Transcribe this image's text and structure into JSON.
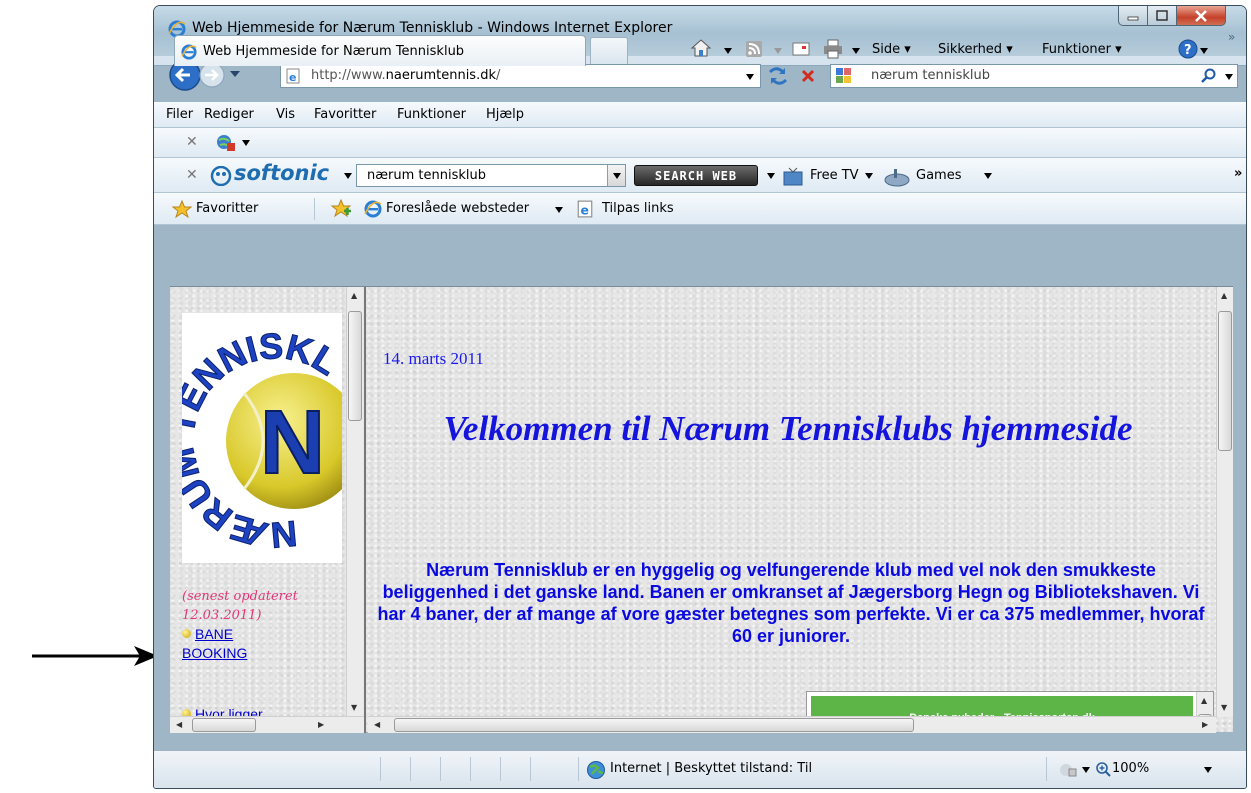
{
  "window": {
    "title": "Web Hjemmeside for Nærum Tennisklub - Windows Internet Explorer"
  },
  "address": {
    "url_prefix": "http://www.",
    "url_domain": "naerumtennis.dk",
    "url_suffix": "/"
  },
  "search": {
    "query": "nærum tennisklub"
  },
  "menu": [
    "Filer",
    "Rediger",
    "Vis",
    "Favoritter",
    "Funktioner",
    "Hjælp"
  ],
  "softonic": {
    "logo": "softonic",
    "query": "nærum tennisklub",
    "button": "SEARCH WEB",
    "free_tv": "Free TV",
    "games": "Games"
  },
  "favorites": {
    "favorites_label": "Favoritter",
    "suggested": "Foreslåede websteder",
    "custom_links": "Tilpas links"
  },
  "tab": {
    "label": "Web Hjemmeside for Nærum Tennisklub"
  },
  "commands": {
    "page": "Side",
    "safety": "Sikkerhed",
    "tools": "Funktioner"
  },
  "page": {
    "date": "14. marts 2011",
    "heading": "Velkommen til Nærum Tennisklubs hjemmeside",
    "intro": "Nærum Tennisklub er en hyggelig og velfungerende klub med vel nok den smukkeste beliggenhed i det ganske land. Banen er omkranset af Jægersborg Hegn og Bibliotekshaven. Vi har 4 baner, der af mange af vore gæster betegnes som perfekte. Vi er ca 375 medlemmer, hvoraf 60 er juniorer.",
    "logo_text": "NÆRUM TENNISKLUB",
    "logo_letter": "N",
    "updated_line1": "(senest opdateret",
    "updated_line2": "12.03.2011)",
    "link_booking_line1": "BANE",
    "link_booking_line2": "BOOKING",
    "link_location": "Hvor ligger",
    "news_title": "Danske nyheder - Tennissporten.dk"
  },
  "status": {
    "zone": "Internet | Beskyttet tilstand: Til",
    "zoom": "100%"
  },
  "colors": {
    "heading": "#1414dd",
    "note": "#e0377a",
    "news": "#5db547",
    "tennis_ball": "#e4d93a"
  }
}
